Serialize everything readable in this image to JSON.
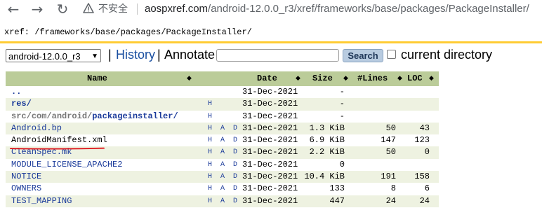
{
  "browser": {
    "insecure_label": "不安全",
    "url_host": "aospxref.com",
    "url_path": "/android-12.0.0_r3/xref/frameworks/base/packages/PackageInstaller/"
  },
  "xref": {
    "path_label": "xref: /frameworks/base/packages/PackageInstaller/"
  },
  "controls": {
    "project_select_value": "android-12.0.0_r3",
    "history_label": "History",
    "annotate_label": "Annotate",
    "search_input_value": "",
    "search_button_label": "Search",
    "current_directory_label": "current directory",
    "pipe": "|"
  },
  "table": {
    "columns": {
      "name": "Name",
      "date": "Date",
      "size": "Size",
      "lines": "#Lines",
      "loc": "LOC"
    },
    "sort_glyph": "◆",
    "rows": [
      {
        "name": "..",
        "links": "",
        "date": "31-Dec-2021",
        "size": "-",
        "lines": "",
        "loc": ""
      },
      {
        "name": "res/",
        "links": "H",
        "date": "31-Dec-2021",
        "size": "-",
        "lines": "",
        "loc": ""
      },
      {
        "name_segments": [
          "src/",
          "com/",
          "android/",
          "packageinstaller/"
        ],
        "links": "H",
        "date": "31-Dec-2021",
        "size": "-",
        "lines": "",
        "loc": ""
      },
      {
        "name": "Android.bp",
        "links": "H A D",
        "date": "31-Dec-2021",
        "size": "1.3 KiB",
        "lines": "50",
        "loc": "43"
      },
      {
        "name": "AndroidManifest.xml",
        "links": "H A D",
        "date": "31-Dec-2021",
        "size": "6.9 KiB",
        "lines": "147",
        "loc": "123"
      },
      {
        "name": "CleanSpec.mk",
        "links": "H A D",
        "date": "31-Dec-2021",
        "size": "2.2 KiB",
        "lines": "50",
        "loc": "0"
      },
      {
        "name": "MODULE_LICENSE_APACHE2",
        "links": "H A D",
        "date": "31-Dec-2021",
        "size": "0",
        "lines": "",
        "loc": ""
      },
      {
        "name": "NOTICE",
        "links": "H A D",
        "date": "31-Dec-2021",
        "size": "10.4 KiB",
        "lines": "191",
        "loc": "158"
      },
      {
        "name": "OWNERS",
        "links": "H A D",
        "date": "31-Dec-2021",
        "size": "133",
        "lines": "8",
        "loc": "6"
      },
      {
        "name": "TEST_MAPPING",
        "links": "H A D",
        "date": "31-Dec-2021",
        "size": "447",
        "lines": "24",
        "loc": "24"
      }
    ]
  },
  "colors": {
    "header_bg": "#bbcc99",
    "alt_row_bg": "#eef2e1",
    "link": "#1a3a9a",
    "rule": "#ffcc33",
    "annotation_red": "#e0262b"
  }
}
